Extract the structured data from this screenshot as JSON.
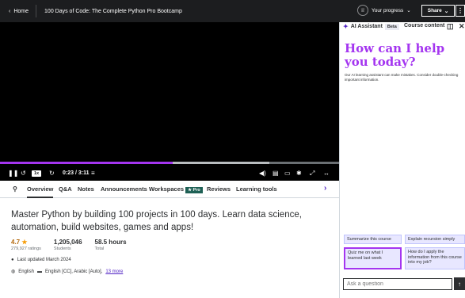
{
  "topbar": {
    "home_label": "Home",
    "course_title": "100 Days of Code: The Complete Python Pro Bootcamp",
    "progress_label": "Your progress",
    "share_label": "Share"
  },
  "player": {
    "speed": "1x",
    "time": "0:23 / 3:11",
    "progress_fraction": 0.51,
    "buffer_fraction": 0.795
  },
  "tabs": [
    "Overview",
    "Q&A",
    "Notes",
    "Announcements",
    "Workspaces",
    "Reviews",
    "Learning tools"
  ],
  "pro_badge": "Pro",
  "overview": {
    "headline": "Master Python by building 100 projects in 100 days. Learn data science, automation, build websites, games and apps!",
    "rating": "4.7",
    "ratings_count": "279,927 ratings",
    "students": "1,205,046",
    "students_label": "Students",
    "hours": "58.5 hours",
    "hours_label": "Total",
    "last_updated": "Last updated March 2024",
    "language": "English",
    "captions": "English [CC], Arabic [Auto],",
    "more_link": "13 more"
  },
  "panel": {
    "ai_tab": "AI Assistant",
    "beta": "Beta",
    "content_tab": "Course content",
    "greeting": "How can I help you today?",
    "disclaimer": "Our AI learning assistant can make mistakes. Consider double-checking important information.",
    "suggestions": [
      "Summarize this course",
      "Explain recursion simply",
      "Quiz me on what I learned last week",
      "How do I apply the information from this course into my job?"
    ],
    "input_placeholder": "Ask a question"
  },
  "colors": {
    "accent": "#a435f0",
    "dark": "#1c1d1f",
    "link": "#5022c3",
    "rating": "#b4690e"
  }
}
